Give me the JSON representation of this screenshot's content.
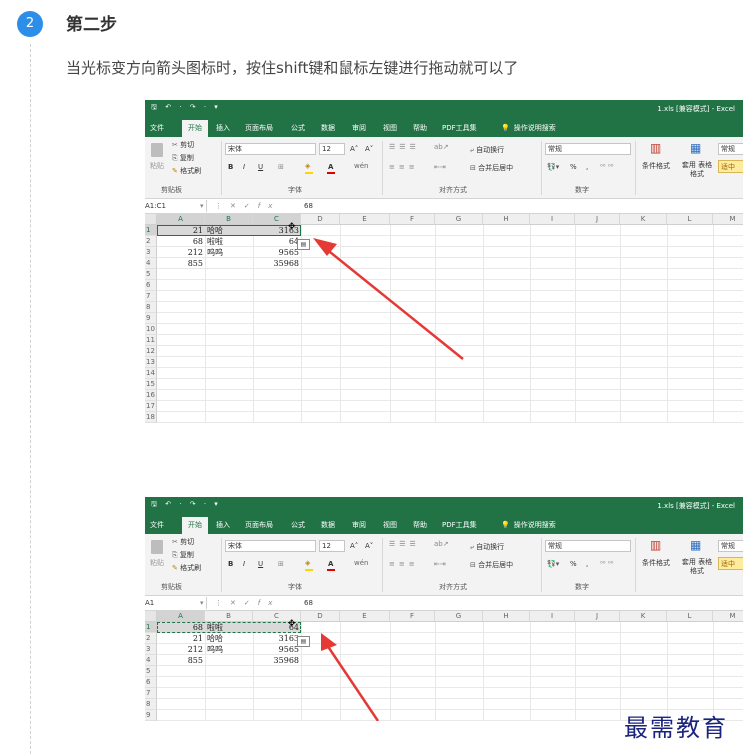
{
  "step": {
    "number": "2",
    "title": "第二步",
    "description": "当光标变方向箭头图标时，按住shift键和鼠标左键进行拖动就可以了"
  },
  "excel": {
    "qa_icons": "🖫 ↶ · ↷ · ▾",
    "window_title": "1.xls [兼容模式] - Excel",
    "tabs": [
      "文件",
      "开始",
      "插入",
      "页面布局",
      "公式",
      "数据",
      "审阅",
      "视图",
      "帮助",
      "PDF工具集",
      "操作说明搜索"
    ],
    "active_tab": "开始",
    "clipboard": {
      "paste": "粘贴",
      "cut": "剪切",
      "copy": "复制",
      "format_painter": "格式刷",
      "group": "剪贴板"
    },
    "font": {
      "name": "宋体",
      "size": "12",
      "group": "字体",
      "bold": "B",
      "italic": "I",
      "underline": "U",
      "grow": "A˄",
      "shrink": "A˅",
      "color_letter": "A",
      "wen": "wén"
    },
    "alignment": {
      "wrap": "自动换行",
      "merge": "合并后居中",
      "group": "对齐方式"
    },
    "number": {
      "format": "常规",
      "group": "数字",
      "percent": "%",
      "comma": ","
    },
    "styles": {
      "conditional": "条件格式",
      "table": "套用 表格格式",
      "normal": "常规",
      "mid": "适中"
    },
    "formula_value": "68",
    "columns": [
      "A",
      "B",
      "C",
      "D",
      "E",
      "F",
      "G",
      "H",
      "I",
      "J",
      "K",
      "L",
      "M"
    ]
  },
  "shot1": {
    "name_box": "A1:C1",
    "rows": [
      "1",
      "2",
      "3",
      "4",
      "5",
      "6",
      "7",
      "8",
      "9",
      "10",
      "11",
      "12",
      "13",
      "14",
      "15",
      "16",
      "17",
      "18"
    ],
    "data": [
      [
        "21",
        "哈哈",
        "3163"
      ],
      [
        "68",
        "啦啦",
        "64"
      ],
      [
        "212",
        "呜呜",
        "9565"
      ],
      [
        "855",
        "",
        "35968"
      ]
    ]
  },
  "shot2": {
    "name_box": "A1",
    "rows": [
      "1",
      "2",
      "3",
      "4",
      "5",
      "6",
      "7",
      "8",
      "9"
    ],
    "data": [
      [
        "68",
        "啦啦",
        "64"
      ],
      [
        "21",
        "哈哈",
        "3163"
      ],
      [
        "212",
        "呜呜",
        "9565"
      ],
      [
        "855",
        "",
        "35968"
      ]
    ]
  },
  "watermark": "最需教育",
  "colors": {
    "excel_green": "#217346",
    "badge_blue": "#2c8ee8",
    "arrow_red": "#e53935"
  }
}
